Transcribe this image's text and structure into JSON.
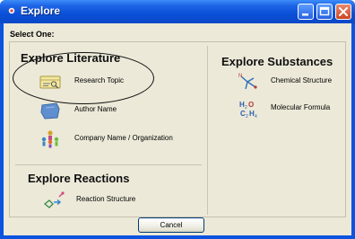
{
  "window": {
    "title": "Explore"
  },
  "dialog": {
    "prompt": "Select One:",
    "literature": {
      "title": "Explore Literature",
      "items": [
        {
          "label": "Research Topic",
          "icon": "research-topic-icon"
        },
        {
          "label": "Author Name",
          "icon": "author-name-icon"
        },
        {
          "label": "Company Name / Organization",
          "icon": "company-org-icon"
        }
      ]
    },
    "substances": {
      "title": "Explore Substances",
      "items": [
        {
          "label": "Chemical Structure",
          "icon": "chemical-structure-icon"
        },
        {
          "label": "Molecular Formula",
          "icon": "molecular-formula-icon"
        }
      ]
    },
    "reactions": {
      "title": "Explore Reactions",
      "items": [
        {
          "label": "Reaction Structure",
          "icon": "reaction-structure-icon"
        }
      ]
    },
    "cancel_label": "Cancel"
  },
  "colors": {
    "titlebar": "#0a54e0",
    "client": "#ece9d8",
    "close_button": "#cc4620"
  }
}
